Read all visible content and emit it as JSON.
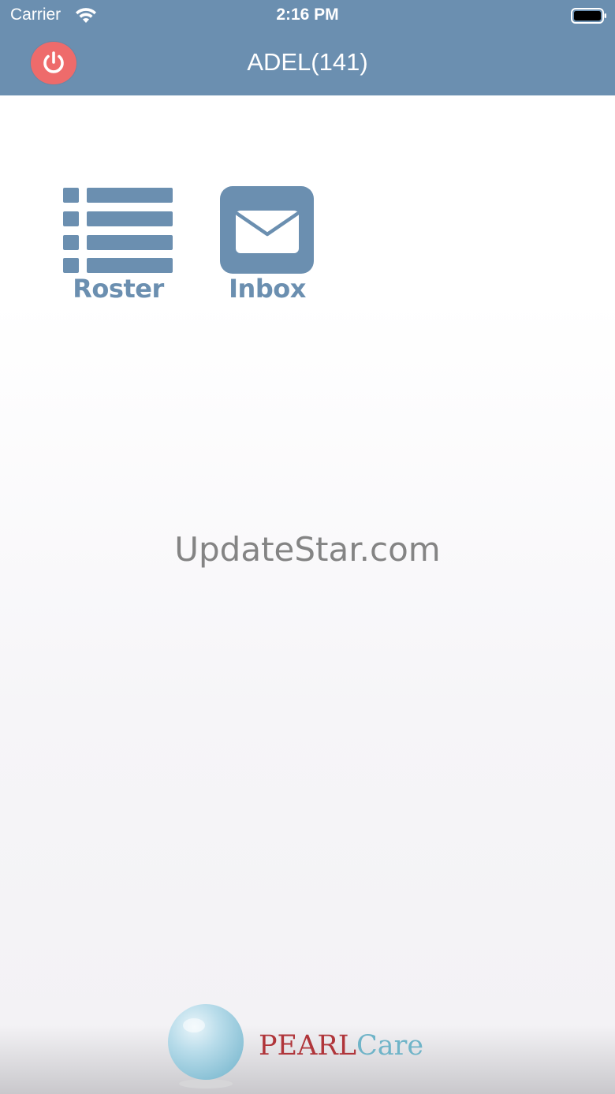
{
  "status_bar": {
    "carrier": "Carrier",
    "time": "2:16 PM"
  },
  "nav": {
    "title": "ADEL(141)"
  },
  "menu": {
    "roster_label": "Roster",
    "inbox_label": "Inbox"
  },
  "watermark": "UpdateStar.com",
  "footer": {
    "brand_strong": "PEARL",
    "brand_light": "Care"
  },
  "colors": {
    "header": "#6b8fb0",
    "power_button": "#ee6b6b",
    "icon_accent": "#6b8fb0",
    "brand_red": "#b0353a",
    "brand_blue": "#6fb4c8"
  },
  "icons": {
    "power": "power-icon",
    "roster": "list-icon",
    "inbox": "envelope-icon",
    "wifi": "wifi-icon",
    "battery": "battery-icon"
  }
}
